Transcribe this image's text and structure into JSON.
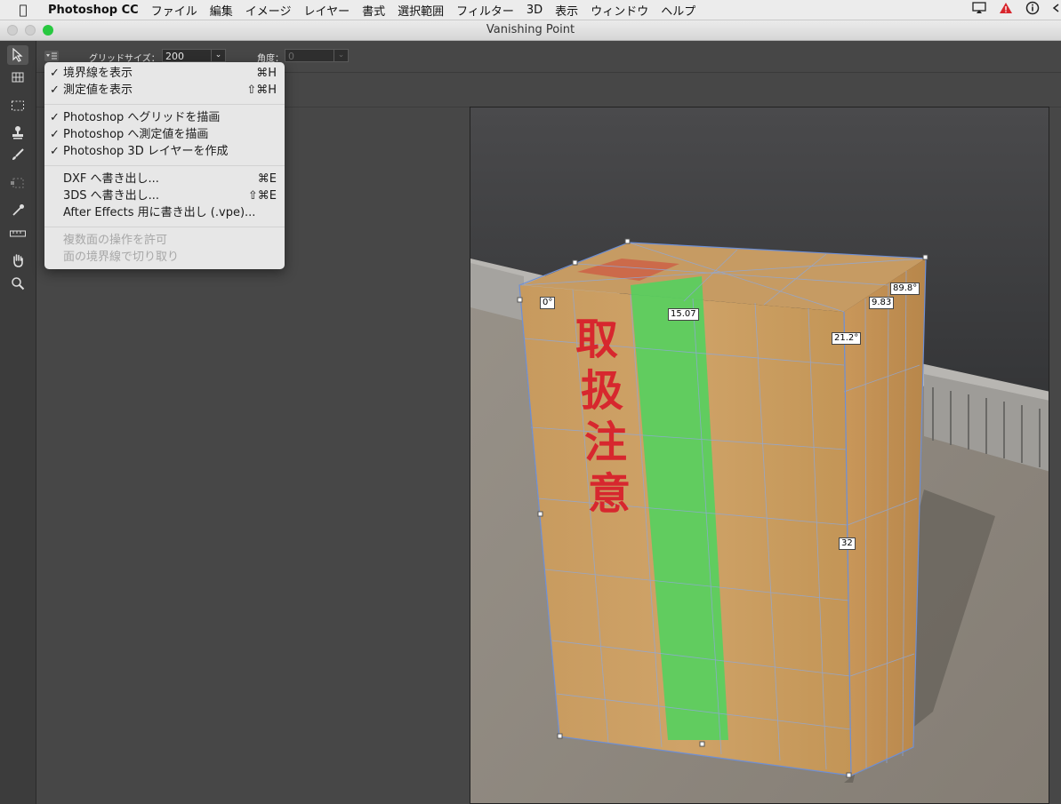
{
  "menubar": {
    "app_name": "Photoshop CC",
    "items": [
      "ファイル",
      "編集",
      "イメージ",
      "レイヤー",
      "書式",
      "選択範囲",
      "フィルター",
      "3D",
      "表示",
      "ウィンドウ",
      "ヘルプ"
    ],
    "status_icons": [
      "airplay-icon",
      "warning-icon",
      "info-icon"
    ]
  },
  "window": {
    "title": "Vanishing Point"
  },
  "options": {
    "grid_size_label": "グリッドサイズ：",
    "grid_size_value": "200",
    "angle_label": "角度：",
    "angle_value": "0"
  },
  "tools": [
    "edit-plane-tool",
    "create-plane-tool",
    "marquee-tool",
    "stamp-tool",
    "brush-tool",
    "transform-tool",
    "eyedropper-tool",
    "measure-tool",
    "hand-tool",
    "zoom-tool"
  ],
  "dropdown": {
    "items": [
      {
        "check": "✓",
        "label": "境界線を表示",
        "shortcut": "⌘H"
      },
      {
        "check": "✓",
        "label": "測定値を表示",
        "shortcut": "⇧⌘H"
      },
      {
        "check": "✓",
        "label": "Photoshop へグリッドを描画",
        "shortcut": ""
      },
      {
        "check": "✓",
        "label": "Photoshop へ測定値を描画",
        "shortcut": ""
      },
      {
        "check": "✓",
        "label": "Photoshop 3D レイヤーを作成",
        "shortcut": ""
      },
      {
        "check": "",
        "label": "DXF へ書き出し...",
        "shortcut": "⌘E"
      },
      {
        "check": "",
        "label": "3DS へ書き出し...",
        "shortcut": "⇧⌘E"
      },
      {
        "check": "",
        "label": "After Effects 用に書き出し (.vpe)...",
        "shortcut": ""
      },
      {
        "check": "",
        "label": "複数面の操作を許可",
        "shortcut": ""
      },
      {
        "check": "",
        "label": "面の境界線で切り取り",
        "shortcut": ""
      }
    ]
  },
  "canvas": {
    "box_text": [
      "取",
      "扱",
      "注",
      "意"
    ],
    "measurements": [
      "0°",
      "15.07",
      "9.83",
      "89.8°",
      "21.2°",
      "32"
    ]
  },
  "colors": {
    "accent_green": "#28c840",
    "warning_red": "#d8262d"
  }
}
